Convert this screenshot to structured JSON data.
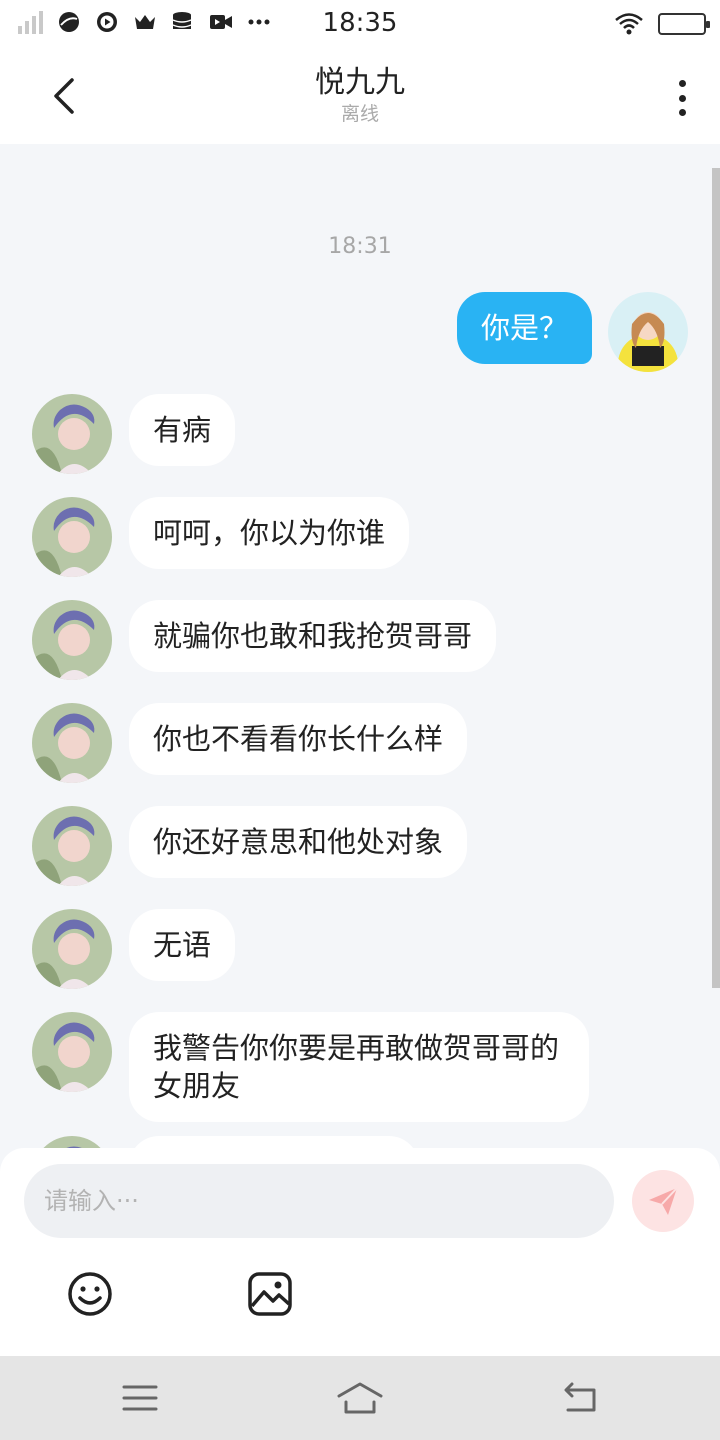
{
  "status_bar": {
    "time": "18:35",
    "icons": [
      "signal-icon",
      "browser-icon",
      "play-icon",
      "crown-icon",
      "database-icon",
      "video-icon",
      "more-dots-icon",
      "wifi-icon",
      "battery-icon"
    ]
  },
  "header": {
    "title": "悦九九",
    "subtitle": "离线",
    "back_icon": "chevron-left-icon",
    "more_icon": "more-vertical-icon"
  },
  "chat": {
    "timestamp": "18:31",
    "messages": [
      {
        "from": "me",
        "text": "你是？"
      },
      {
        "from": "other",
        "text": "有病"
      },
      {
        "from": "other",
        "text": "呵呵，你以为你谁"
      },
      {
        "from": "other",
        "text": "就骗你也敢和我抢贺哥哥"
      },
      {
        "from": "other",
        "text": "你也不看看你长什么样"
      },
      {
        "from": "other",
        "text": "你还好意思和他处对象"
      },
      {
        "from": "other",
        "text": "无语"
      },
      {
        "from": "other",
        "text": "我警告你你要是再敢做贺哥哥的女朋友"
      }
    ]
  },
  "composer": {
    "placeholder": "请输入···",
    "send_icon": "send-icon",
    "emoji_icon": "emoji-icon",
    "image_icon": "image-icon",
    "send_color": "#f7a9a9"
  },
  "navbar": {
    "icons": [
      "menu-icon",
      "home-icon",
      "back-icon"
    ]
  },
  "colors": {
    "accent": "#29b3f3",
    "background": "#f4f6f9"
  }
}
